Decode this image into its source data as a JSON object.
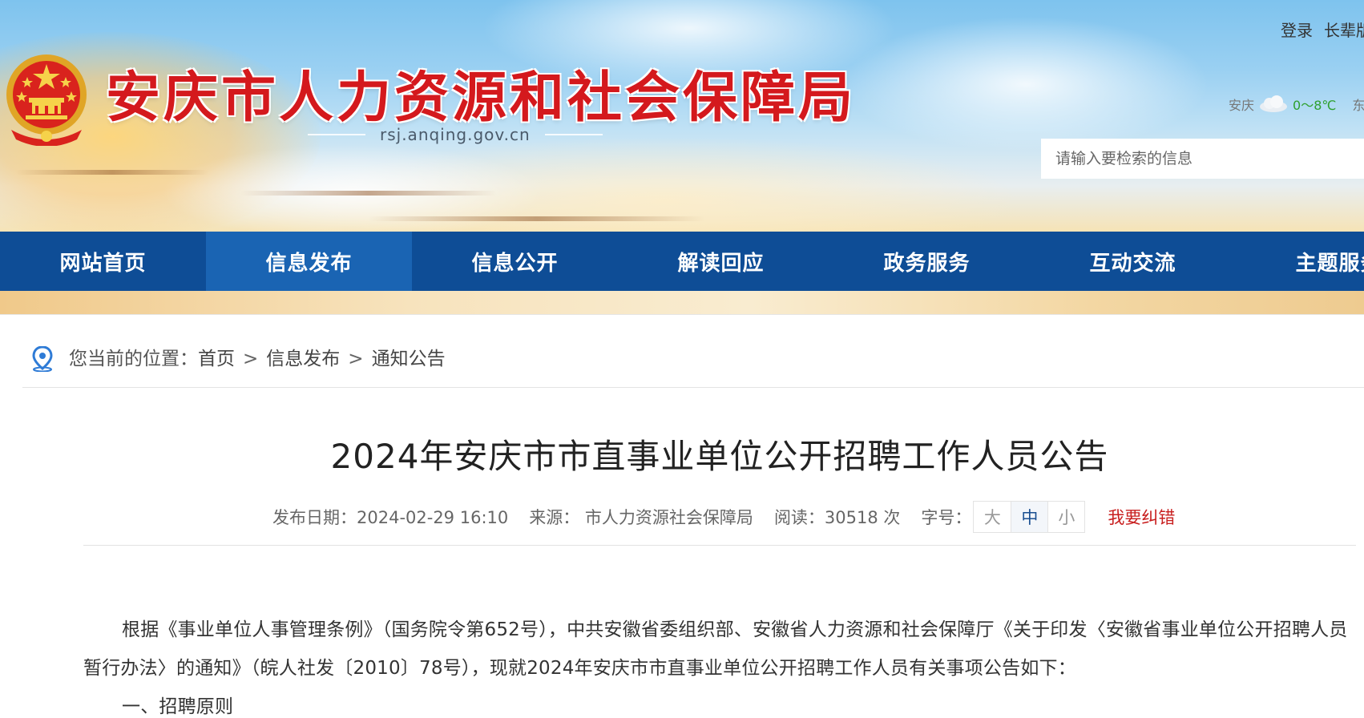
{
  "header": {
    "site_title": "安庆市人力资源和社会保障局",
    "site_url": "rsj.anqing.gov.cn",
    "top_links": [
      "登录",
      "长辈版"
    ],
    "weather": {
      "city": "安庆",
      "temp": "0～8℃",
      "wind": "东"
    },
    "search_placeholder": "请输入要检索的信息"
  },
  "nav": {
    "items": [
      "网站首页",
      "信息发布",
      "信息公开",
      "解读回应",
      "政务服务",
      "互动交流",
      "主题服务"
    ],
    "active_index": 1
  },
  "breadcrumb": {
    "prefix": "您当前的位置：",
    "items": [
      "首页",
      "信息发布",
      "通知公告"
    ],
    "separator": ">"
  },
  "article": {
    "title": "2024年安庆市市直事业单位公开招聘工作人员公告",
    "publish_date": "发布日期：2024-02-29 16:10",
    "source": "来源：  市人力资源社会保障局",
    "reads": "阅读：30518 次",
    "font_size_label": "字号：",
    "font_sizes": [
      "大",
      "中",
      "小"
    ],
    "font_size_active": "中",
    "correction": "我要纠错",
    "paragraphs": [
      "根据《事业单位人事管理条例》（国务院令第652号），中共安徽省委组织部、安徽省人力资源和社会保障厅《关于印发〈安徽省事业单位公开招聘人员暂行办法〉的通知》（皖人社发〔2010〕78号），现就2024年安庆市市直事业单位公开招聘工作人员有关事项公告如下："
    ],
    "section_heading": "一、招聘原则"
  },
  "colors": {
    "nav_bg": "#0e4d96",
    "nav_active": "#1a64b3",
    "title_red": "#d4191d",
    "correction_red": "#c81e1e"
  }
}
